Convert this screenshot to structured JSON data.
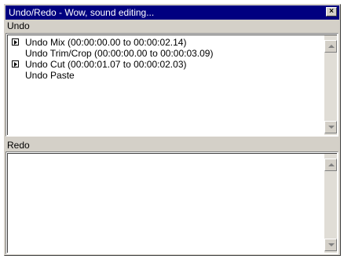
{
  "window": {
    "title": "Undo/Redo - Wow, sound editing...",
    "close_glyph": "×"
  },
  "undo": {
    "label": "Undo",
    "items": [
      {
        "label": "Undo Mix (00:00:00.00 to 00:00:02.14)",
        "marker": true
      },
      {
        "label": "Undo Trim/Crop (00:00:00.00 to 00:00:03.09)",
        "marker": false
      },
      {
        "label": "Undo Cut (00:00:01.07 to 00:00:02.03)",
        "marker": true
      },
      {
        "label": "Undo Paste",
        "marker": false
      }
    ]
  },
  "redo": {
    "label": "Redo",
    "items": []
  },
  "icons": {
    "close": "close-icon",
    "marker": "play-marker-icon",
    "scroll_up": "arrow-up-icon",
    "scroll_down": "arrow-down-icon"
  },
  "colors": {
    "title_bar": "#000080",
    "window_face": "#d4d0c8",
    "list_background": "#ffffff"
  }
}
